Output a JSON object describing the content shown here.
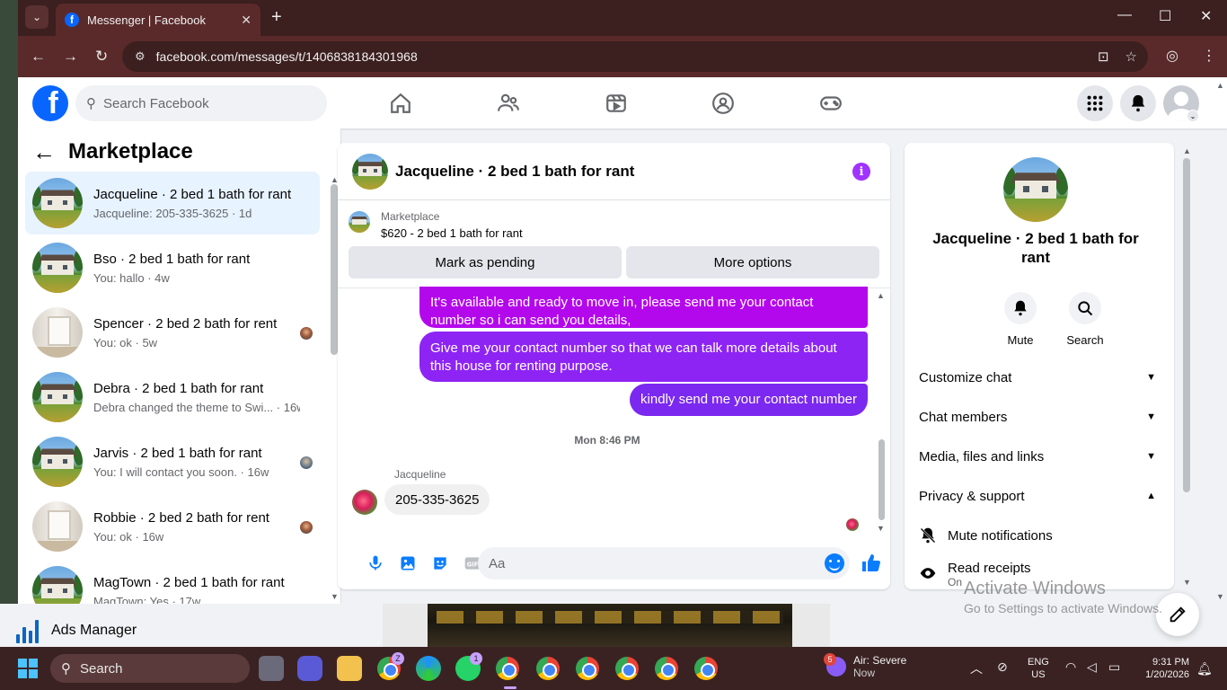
{
  "browser": {
    "tab_title": "Messenger | Facebook",
    "url": "facebook.com/messages/t/1406838184301968"
  },
  "header": {
    "search_placeholder": "Search Facebook"
  },
  "left_panel": {
    "title": "Marketplace",
    "conversations": [
      {
        "name": "Jacqueline · 2 bed 1 bath for rant",
        "preview": "Jacqueline: 205-335-3625 · 1d",
        "thumb": "house",
        "active": true
      },
      {
        "name": "Bso · 2 bed 1 bath for rant",
        "preview": "You: hallo · 4w",
        "thumb": "house"
      },
      {
        "name": "Spencer · 2 bed 2 bath for rent",
        "preview": "You: ok · 5w",
        "thumb": "room"
      },
      {
        "name": "Debra · 2 bed 1 bath for rant",
        "preview": "Debra changed the theme to Swi... · 16w",
        "thumb": "house"
      },
      {
        "name": "Jarvis · 2 bed 1 bath for rant",
        "preview": "You: I will contact you soon. · 16w",
        "thumb": "house"
      },
      {
        "name": "Robbie · 2 bed 2 bath for rent",
        "preview": "You: ok · 16w",
        "thumb": "room"
      },
      {
        "name": "MagTown · 2 bed 1 bath for rant",
        "preview": "MagTown: Yes · 17w",
        "thumb": "house"
      }
    ]
  },
  "chat": {
    "title": "Jacqueline · 2 bed 1 bath for rant",
    "marketplace_label": "Marketplace",
    "listing": "$620 - 2 bed 1 bath for rant",
    "mark_pending": "Mark as pending",
    "more_options": "More options",
    "outgoing": [
      "It's available and ready to move in, please send me your contact number so i can send you details,",
      "Give me your contact number so that we can talk more details about this house for renting purpose.",
      "kindly send me your contact number"
    ],
    "timestamp": "Mon 8:46 PM",
    "sender": "Jacqueline",
    "incoming": "205-335-3625",
    "composer_placeholder": "Aa",
    "accent": "#a033ff"
  },
  "right_panel": {
    "title": "Jacqueline · 2 bed 1 bath for rant",
    "mute": "Mute",
    "search": "Search",
    "sections": [
      {
        "label": "Customize chat",
        "expanded": false
      },
      {
        "label": "Chat members",
        "expanded": false
      },
      {
        "label": "Media, files and links",
        "expanded": false
      },
      {
        "label": "Privacy & support",
        "expanded": true
      }
    ],
    "mute_notifications": "Mute notifications",
    "read_receipts": "Read receipts",
    "read_receipts_state": "On"
  },
  "overlay": {
    "activate_title": "Activate Windows",
    "activate_sub": "Go to Settings to activate Windows."
  },
  "desktop": {
    "ads_manager": "Ads Manager"
  },
  "taskbar": {
    "search": "Search",
    "weather_title": "Air: Severe",
    "weather_sub": "Now",
    "weather_badge": "5",
    "lang_1": "ENG",
    "lang_2": "US",
    "time": "9:31 PM",
    "date": "1/20/2026",
    "badge_chrome": "Z",
    "badge_whatsapp": "1"
  }
}
